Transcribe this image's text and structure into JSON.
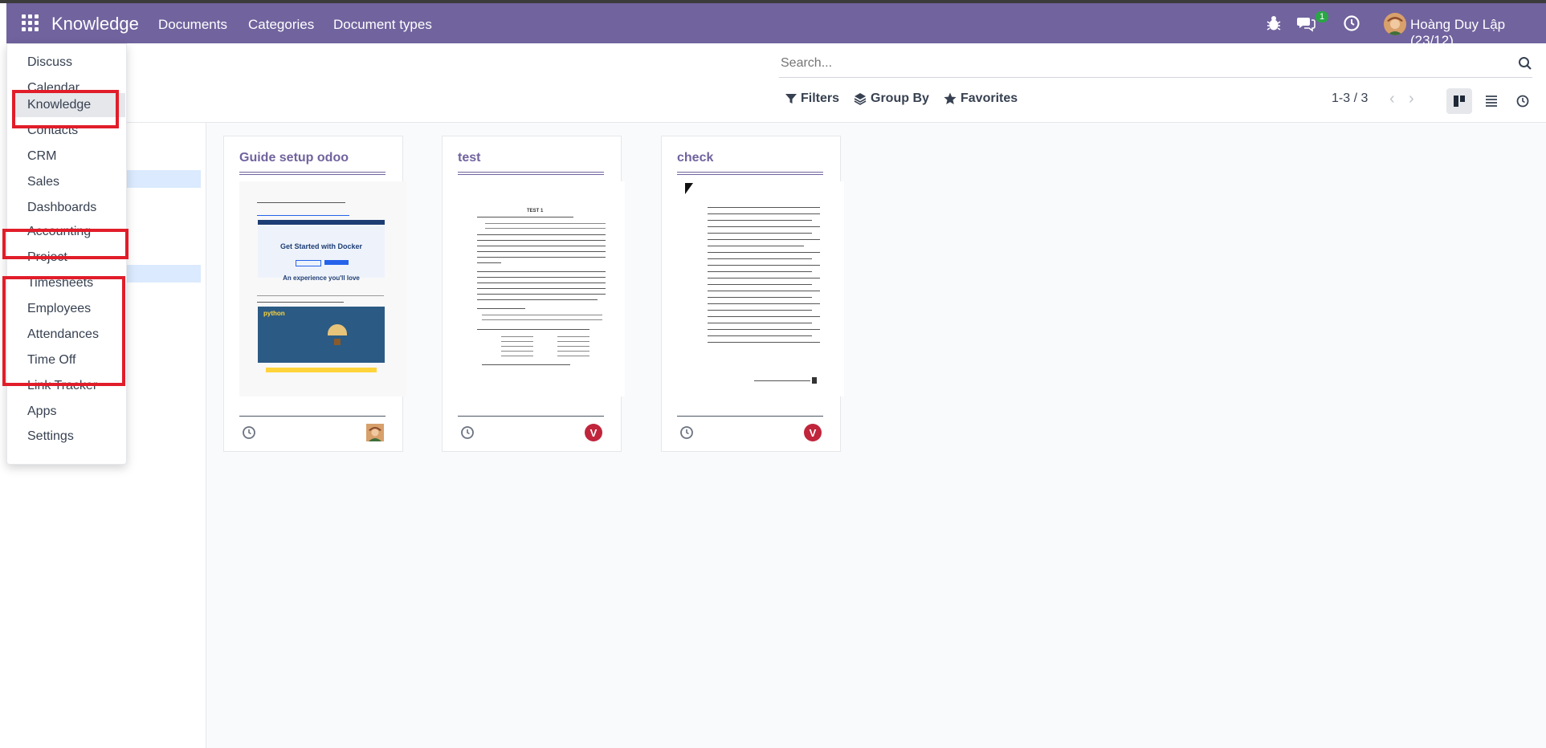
{
  "navbar": {
    "app_title": "Knowledge",
    "menu": [
      "Documents",
      "Categories",
      "Document types"
    ],
    "messages_badge": "1",
    "user_name": "Hoàng Duy Lập (23/12)"
  },
  "search": {
    "placeholder": "Search..."
  },
  "controls": {
    "filters": "Filters",
    "group_by": "Group By",
    "favorites": "Favorites",
    "pager": "1-3 / 3"
  },
  "cards": [
    {
      "title": "Guide setup odoo",
      "avatar": ""
    },
    {
      "title": "test",
      "avatar": "V"
    },
    {
      "title": "check",
      "avatar": "V"
    }
  ],
  "apps_menu": [
    "Discuss",
    "Calendar",
    "Knowledge",
    "Contacts",
    "CRM",
    "Sales",
    "Dashboards",
    "Accounting",
    "Project",
    "Timesheets",
    "Employees",
    "Attendances",
    "Time Off",
    "Link Tracker",
    "Apps",
    "Settings"
  ],
  "thumbnails": {
    "docker_heading": "Get Started with Docker",
    "docker_subheading": "An experience you'll love",
    "python_brand": "python",
    "test_heading": "TEST 1"
  },
  "colors": {
    "brand": "#71639e",
    "highlight": "#e11d2a",
    "avatar_v": "#c0253c"
  },
  "icons": [
    "apps-grid-icon",
    "bug-icon",
    "chat-icon",
    "clock-icon",
    "search-icon",
    "filter-icon",
    "layers-icon",
    "star-icon",
    "kanban-view-icon",
    "list-view-icon",
    "activity-view-icon"
  ]
}
